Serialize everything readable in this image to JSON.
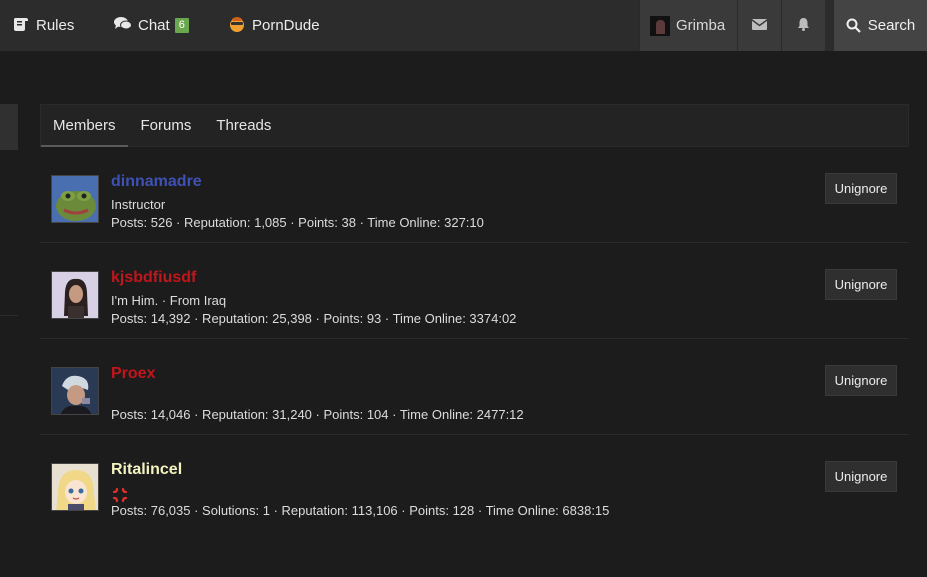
{
  "topbar": {
    "rules_label": "Rules",
    "chat_label": "Chat",
    "chat_badge": "6",
    "porndude_label": "PornDude",
    "username": "Grimba",
    "search_label": "Search"
  },
  "tabs": [
    {
      "label": "Members",
      "active": true
    },
    {
      "label": "Forums",
      "active": false
    },
    {
      "label": "Threads",
      "active": false
    }
  ],
  "members": [
    {
      "name": "dinnamadre",
      "name_color": "#3f51b5",
      "title": "Instructor",
      "stats": "Posts: 526 · Reputation: 1,085 · Points: 38 · Time Online: 327:10",
      "button": "Unignore"
    },
    {
      "name": "kjsbdfiusdf",
      "name_color": "#c0161c",
      "title": "I'm Him.  · From Iraq",
      "stats": "Posts: 14,392 · Reputation: 25,398 · Points: 93 · Time Online: 3374:02",
      "button": "Unignore"
    },
    {
      "name": "Proex",
      "name_color": "#c0161c",
      "title": "",
      "stats": "Posts: 14,046 · Reputation: 31,240 · Points: 104 · Time Online: 2477:12",
      "button": "Unignore"
    },
    {
      "name": "Ritalincel",
      "name_color": "#f3f3c0",
      "title": "",
      "title_icon": "anger-symbol-icon",
      "stats": "Posts: 76,035 · Solutions: 1 · Reputation: 113,106 · Points: 128 · Time Online: 6838:15",
      "button": "Unignore"
    }
  ]
}
